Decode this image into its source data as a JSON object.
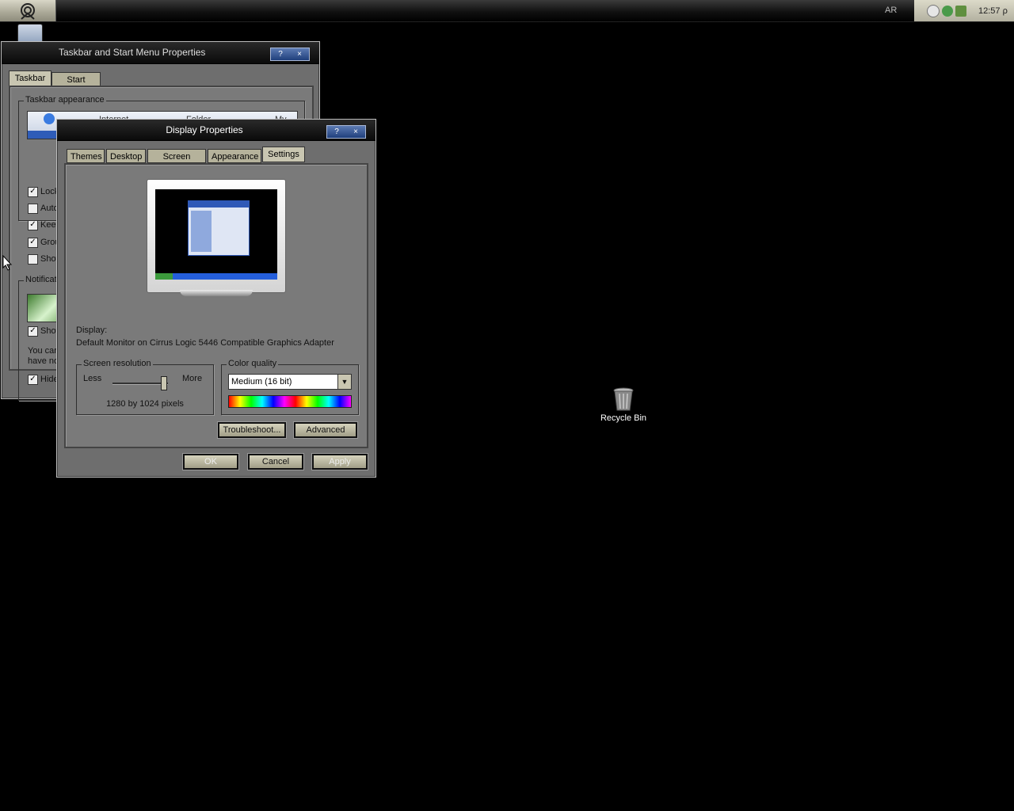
{
  "taskbar": {
    "language": "AR",
    "clock": "12:57 ρ"
  },
  "taskbar_window": {
    "title": "Taskbar and Start Menu Properties",
    "help": "?",
    "close": "×",
    "tabs": [
      "Taskbar",
      "Start Menu"
    ],
    "appearance_group": "Taskbar appearance",
    "preview_items": [
      "Internet",
      "Folder",
      "My"
    ],
    "options": [
      {
        "label": "Lock",
        "checked": true
      },
      {
        "label": "Auto",
        "checked": false
      },
      {
        "label": "Keep",
        "checked": true
      },
      {
        "label": "Grou",
        "checked": true
      },
      {
        "label": "Show",
        "checked": false
      }
    ],
    "notification_group": "Notificat",
    "show_clock": {
      "label": "Show",
      "checked": true
    },
    "text_line1": "You car",
    "text_line2": "have no",
    "hide": {
      "label": "Hide",
      "checked": true
    }
  },
  "display_window": {
    "title": "Display Properties",
    "help": "?",
    "close": "×",
    "tabs": [
      "Themes",
      "Desktop",
      "Screen Saver",
      "Appearance",
      "Settings"
    ],
    "active_tab": "Settings",
    "display_label": "Display:",
    "display_value": "Default Monitor on Cirrus Logic 5446 Compatible Graphics Adapter",
    "resolution_group": "Screen resolution",
    "less": "Less",
    "more": "More",
    "resolution_value": "1280 by 1024 pixels",
    "resolution_slider_level": 1.0,
    "color_group": "Color quality",
    "color_value": "Medium (16 bit)",
    "troubleshoot": "Troubleshoot...",
    "advanced": "Advanced",
    "ok": "OK",
    "cancel": "Cancel",
    "apply": "Apply"
  },
  "desktop": {
    "recycle_bin": "Recycle Bin"
  },
  "colors": {
    "titlebar": "#0a0a0a",
    "window_body": "#7a7a7a",
    "button_face": "#c9c6b1"
  }
}
